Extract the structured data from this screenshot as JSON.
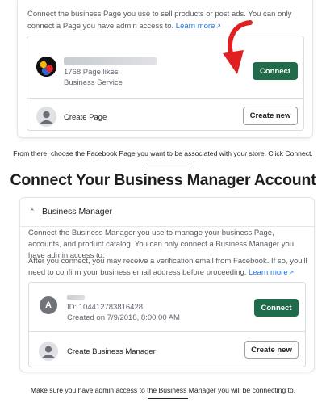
{
  "top_card": {
    "intro_text": "Connect the business Page you use to sell products or post ads. You can only connect a Page you have admin access to.",
    "learn_more": "Learn more",
    "page": {
      "likes": "1768 Page likes",
      "category": "Business Service",
      "connect_label": "Connect"
    },
    "create_page": {
      "label": "Create Page",
      "button": "Create new"
    }
  },
  "caption_1": "From there, choose the Facebook Page you want to be associated with your store. Click Connect.",
  "section_heading": "Connect Your Business Manager Account",
  "bm_card": {
    "title": "Business Manager",
    "para_1": "Connect the Business Manager you use to manage your business Page, accounts, and product catalog. You can only connect a Business Manager you have admin access to.",
    "para_2": "After you connect, you may receive a verification email from Facebook. If so, you'll need to confirm your business email address before proceeding.",
    "learn_more": "Learn more",
    "account": {
      "avatar_letter": "A",
      "id_line": "ID: 104412783816428",
      "created_line": "Created on 7/9/2018, 8:00:00 AM",
      "connect_label": "Connect"
    },
    "create_bm": {
      "label": "Create Business Manager",
      "button": "Create new"
    }
  },
  "caption_2": "Make sure you have admin access to the Business Manager you will be connecting to.",
  "colors": {
    "connect_green": "#1f6b4a",
    "link_blue": "#1b74e4",
    "annotation_red": "#e02020"
  },
  "icons": [
    "external-link-icon",
    "chevron-up-icon",
    "user-placeholder-icon",
    "annotation-arrow-icon"
  ]
}
